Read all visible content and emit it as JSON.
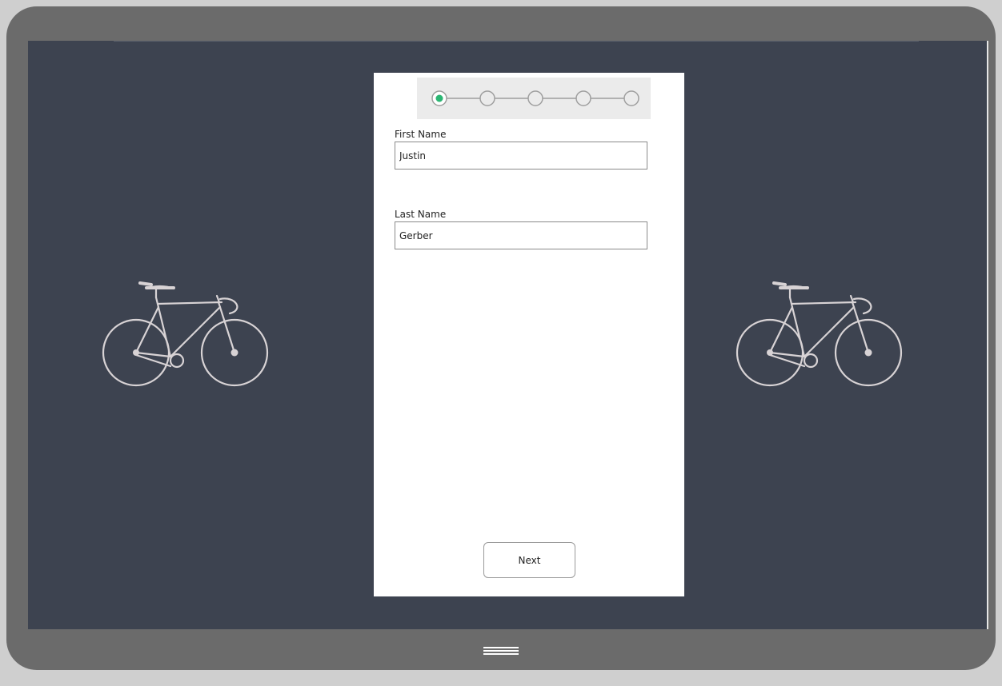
{
  "app": {
    "colors": {
      "device_frame": "#6b6b6b",
      "screen_background": "#3d4350",
      "card_background": "#ffffff",
      "stepper_background": "#ebebeb",
      "active_step": "#2bb673",
      "inactive_step": "#9e9e9e",
      "bike_stroke": "#d8d3d5"
    },
    "decorations": {
      "left_image": "bicycle-icon",
      "right_image": "bicycle-icon",
      "home_button": "menu-lines-icon"
    }
  },
  "stepper": {
    "total_steps": 5,
    "current_step": 1
  },
  "form": {
    "first_name": {
      "label": "First Name",
      "value": "Justin"
    },
    "last_name": {
      "label": "Last Name",
      "value": "Gerber"
    },
    "next_label": "Next"
  }
}
